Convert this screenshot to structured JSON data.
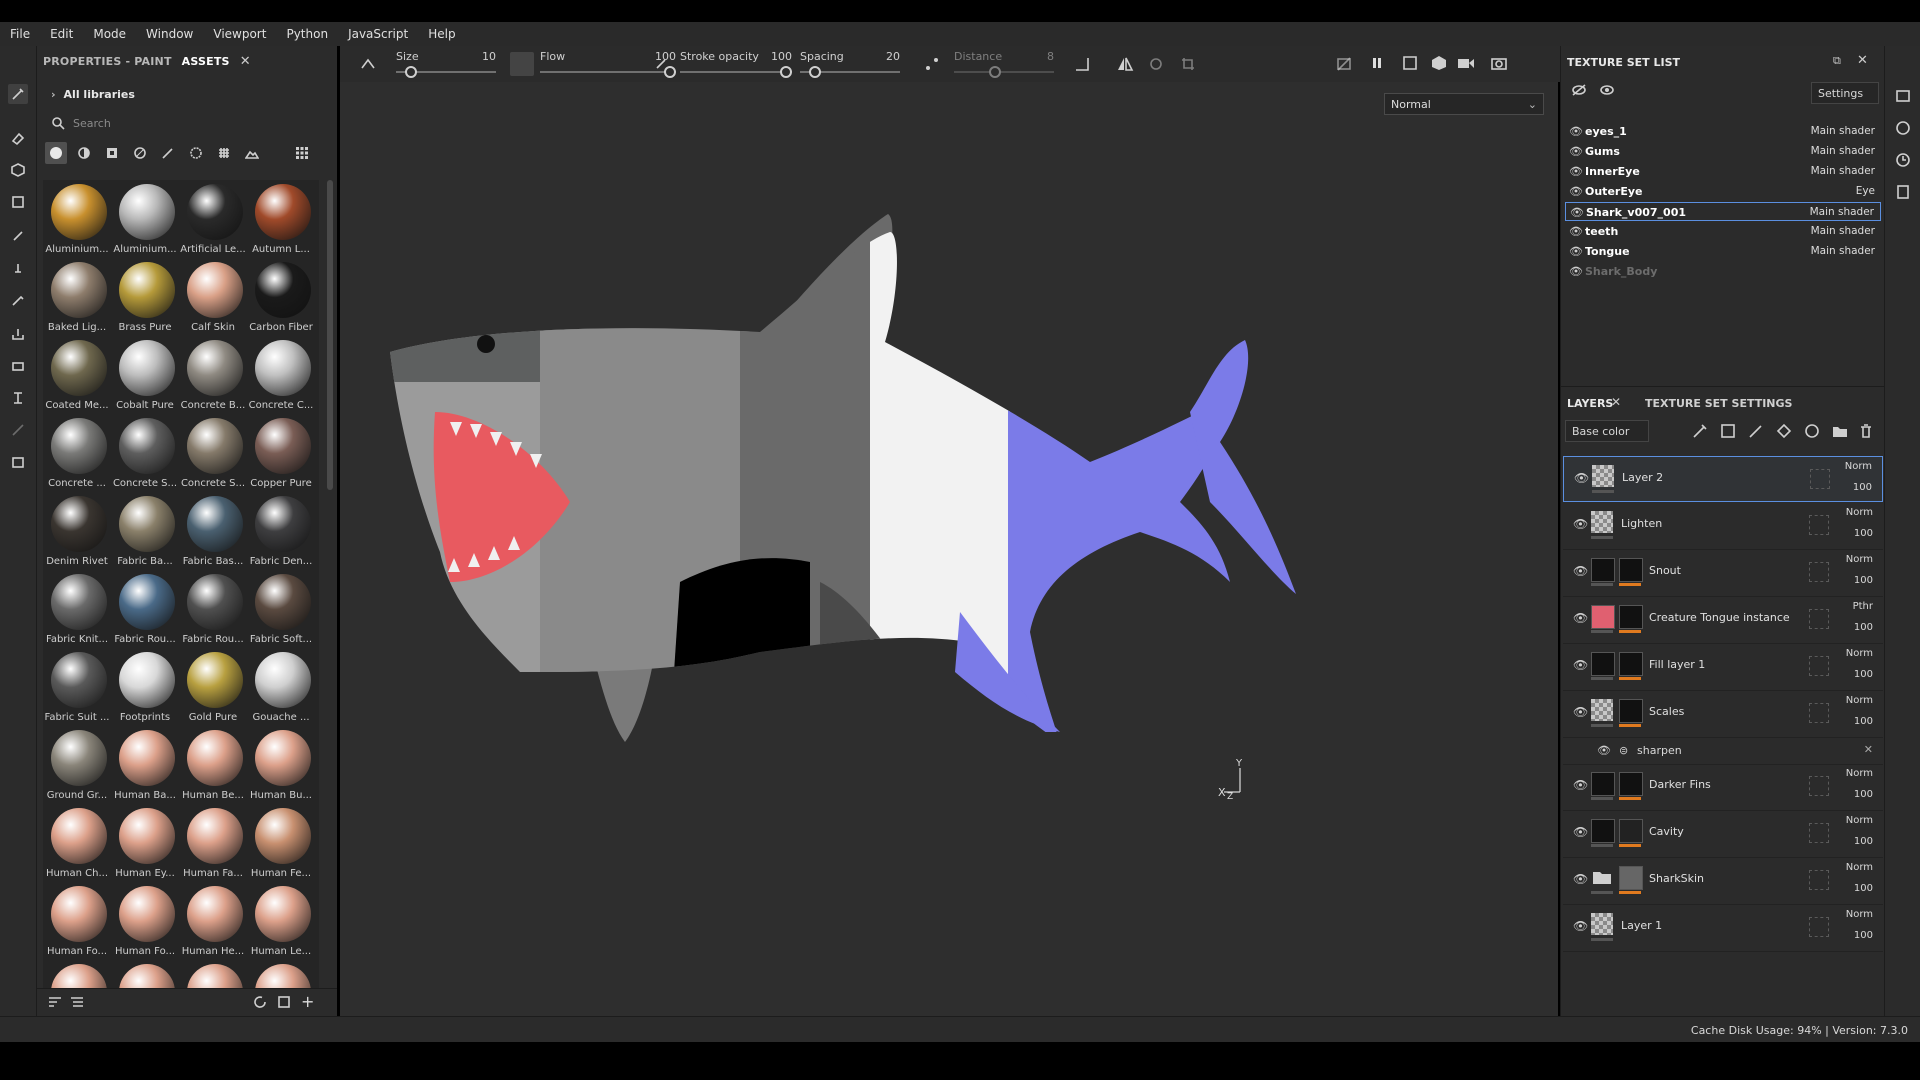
{
  "menu": [
    "File",
    "Edit",
    "Mode",
    "Window",
    "Viewport",
    "Python",
    "JavaScript",
    "Help"
  ],
  "assets": {
    "tab_properties": "PROPERTIES - PAINT",
    "tab_assets": "ASSETS",
    "library": "All libraries",
    "search_placeholder": "Search",
    "materials": [
      {
        "name": "Aluminium...",
        "color": "#c8902e"
      },
      {
        "name": "Aluminium...",
        "color": "#b8b8b8"
      },
      {
        "name": "Artificial Le...",
        "color": "#2a2a2a"
      },
      {
        "name": "Autumn L...",
        "color": "#a04a2a"
      },
      {
        "name": "Baked Lig...",
        "color": "#8e7d6c"
      },
      {
        "name": "Brass Pure",
        "color": "#b59a3a"
      },
      {
        "name": "Calf Skin",
        "color": "#d9a087"
      },
      {
        "name": "Carbon Fiber",
        "color": "#1a1a1a"
      },
      {
        "name": "Coated Me...",
        "color": "#6f684e"
      },
      {
        "name": "Cobalt Pure",
        "color": "#bdbdbd"
      },
      {
        "name": "Concrete B...",
        "color": "#8f8a82"
      },
      {
        "name": "Concrete C...",
        "color": "#c0c0c0"
      },
      {
        "name": "Concrete ...",
        "color": "#7a7a78"
      },
      {
        "name": "Concrete S...",
        "color": "#5e5e5e"
      },
      {
        "name": "Concrete S...",
        "color": "#857a6a"
      },
      {
        "name": "Copper Pure",
        "color": "#7a5d55"
      },
      {
        "name": "Denim Rivet",
        "color": "#3a3530"
      },
      {
        "name": "Fabric Ba...",
        "color": "#8a806a"
      },
      {
        "name": "Fabric Bas...",
        "color": "#4a6070"
      },
      {
        "name": "Fabric Den...",
        "color": "#3e3e40"
      },
      {
        "name": "Fabric Knit...",
        "color": "#6a6a6a"
      },
      {
        "name": "Fabric Rou...",
        "color": "#4a6a88"
      },
      {
        "name": "Fabric Rou...",
        "color": "#505050"
      },
      {
        "name": "Fabric Soft...",
        "color": "#5a4a40"
      },
      {
        "name": "Fabric Suit ...",
        "color": "#5a5a5a"
      },
      {
        "name": "Footprints",
        "color": "#d8d8d8"
      },
      {
        "name": "Gold Pure",
        "color": "#b8a040"
      },
      {
        "name": "Gouache ...",
        "color": "#cfcfcf"
      },
      {
        "name": "Ground Gr...",
        "color": "#8a857a"
      },
      {
        "name": "Human Ba...",
        "color": "#dca08a"
      },
      {
        "name": "Human Be...",
        "color": "#dca08a"
      },
      {
        "name": "Human Bu...",
        "color": "#dca08a"
      },
      {
        "name": "Human Ch...",
        "color": "#dca08a"
      },
      {
        "name": "Human Ey...",
        "color": "#dca08a"
      },
      {
        "name": "Human Fa...",
        "color": "#dca08a"
      },
      {
        "name": "Human Fe...",
        "color": "#c89070"
      },
      {
        "name": "Human Fo...",
        "color": "#dca08a"
      },
      {
        "name": "Human Fo...",
        "color": "#dca08a"
      },
      {
        "name": "Human He...",
        "color": "#dca08a"
      },
      {
        "name": "Human Le...",
        "color": "#dca08a"
      },
      {
        "name": "",
        "color": "#dca08a"
      },
      {
        "name": "",
        "color": "#dca08a"
      },
      {
        "name": "",
        "color": "#dca08a"
      },
      {
        "name": "",
        "color": "#dca08a"
      }
    ]
  },
  "toolbar": {
    "size_label": "Size",
    "size_value": "10",
    "size_fraction": 0.1,
    "flow_label": "Flow",
    "flow_value": "100",
    "flow_fraction": 1.0,
    "opacity_label": "Stroke opacity",
    "opacity_value": "100",
    "opacity_fraction": 1.0,
    "spacing_label": "Spacing",
    "spacing_value": "20",
    "spacing_fraction": 0.1,
    "distance_label": "Distance",
    "distance_value": "8",
    "distance_fraction": 0.4
  },
  "viewport": {
    "blend_mode": "Normal",
    "axis_labels": "X Z Y"
  },
  "texture_set_list": {
    "title": "TEXTURE SET LIST",
    "settings": "Settings",
    "items": [
      {
        "name": "eyes_1",
        "shader": "Main shader"
      },
      {
        "name": "Gums",
        "shader": "Main shader"
      },
      {
        "name": "InnerEye",
        "shader": "Main shader"
      },
      {
        "name": "OuterEye",
        "shader": "Eye"
      },
      {
        "name": "Shark_v007_001",
        "shader": "Main shader",
        "selected": true
      },
      {
        "name": "teeth",
        "shader": "Main shader"
      },
      {
        "name": "Tongue",
        "shader": "Main shader"
      },
      {
        "name": "Shark_Body",
        "shader": "",
        "disabled": true
      }
    ]
  },
  "layers": {
    "tab_layers": "LAYERS",
    "tab_settings": "TEXTURE SET SETTINGS",
    "channel": "Base color",
    "items": [
      {
        "name": "Layer 2",
        "blend": "Norm",
        "opacity": "100",
        "selected": true
      },
      {
        "name": "Lighten",
        "blend": "Norm",
        "opacity": "100"
      },
      {
        "name": "Snout",
        "blend": "Norm",
        "opacity": "100"
      },
      {
        "name": "Creature Tongue instance",
        "blend": "Pthr",
        "opacity": "100"
      },
      {
        "name": "Fill layer 1",
        "blend": "Norm",
        "opacity": "100"
      },
      {
        "name": "Scales",
        "blend": "Norm",
        "opacity": "100"
      },
      {
        "name": "sharpen",
        "filter": true
      },
      {
        "name": "Darker Fins",
        "blend": "Norm",
        "opacity": "100"
      },
      {
        "name": "Cavity",
        "blend": "Norm",
        "opacity": "100"
      },
      {
        "name": "SharkSkin",
        "blend": "Norm",
        "opacity": "100"
      },
      {
        "name": "Layer 1",
        "blend": "Norm",
        "opacity": "100"
      }
    ]
  },
  "status": "Cache Disk Usage:   94% | Version: 7.3.0"
}
